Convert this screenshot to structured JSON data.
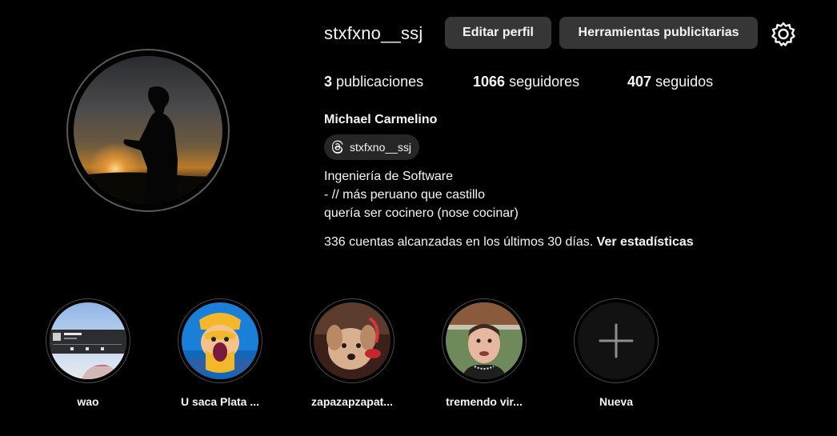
{
  "profile": {
    "username": "stxfxno__ssj",
    "edit_button": "Editar perfil",
    "tools_button": "Herramientas publicitarias",
    "full_name": "Michael Carmelino",
    "threads_handle": "stxfxno__ssj",
    "bio": [
      "Ingeniería de Software",
      "- // más peruano que castillo",
      "quería ser cocinero (nose cocinar)"
    ]
  },
  "stats": {
    "posts_count": "3",
    "posts_label": "publicaciones",
    "followers_count": "1066",
    "followers_label": "seguidores",
    "following_count": "407",
    "following_label": "seguidos"
  },
  "insights": {
    "text": "336 cuentas alcanzadas en los últimos 30 días.",
    "link": "Ver estadísticas"
  },
  "highlights": [
    {
      "label": "wao"
    },
    {
      "label": "U saca Plata ..."
    },
    {
      "label": "zapazapzapat..."
    },
    {
      "label": "tremendo vir..."
    },
    {
      "label": "Nueva"
    }
  ],
  "icons": {
    "settings": "gear-icon",
    "threads": "threads-icon",
    "add": "plus-icon"
  },
  "colors": {
    "background": "#000000",
    "button": "#363636",
    "text": "#f5f5f5"
  }
}
